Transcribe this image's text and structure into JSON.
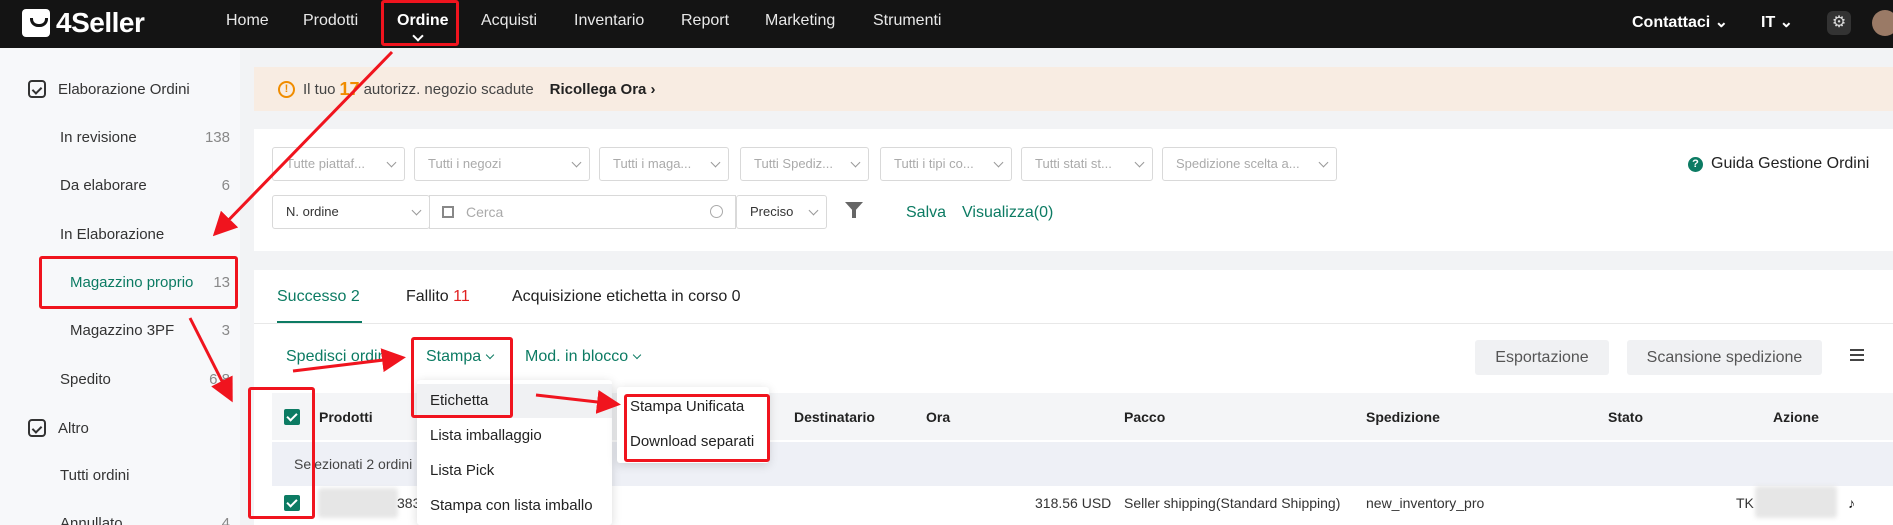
{
  "app": {
    "logo": "4Seller"
  },
  "nav": {
    "items": [
      "Home",
      "Prodotti",
      "Ordine",
      "Acquisti",
      "Inventario",
      "Report",
      "Marketing",
      "Strumenti"
    ],
    "active": "Ordine",
    "contact": "Contattaci",
    "lang": "IT"
  },
  "sidebar": {
    "group1": "Elaborazione Ordini",
    "items": [
      {
        "label": "In revisione",
        "count": "138"
      },
      {
        "label": "Da elaborare",
        "count": "6"
      },
      {
        "label": "In Elaborazione",
        "count": ""
      },
      {
        "label": "Magazzino proprio",
        "count": "13"
      },
      {
        "label": "Magazzino 3PF",
        "count": "3"
      },
      {
        "label": "Spedito",
        "count": "6.8"
      }
    ],
    "group2": "Altro",
    "items2": [
      {
        "label": "Tutti ordini",
        "count": ""
      },
      {
        "label": "Annullato",
        "count": "4"
      }
    ]
  },
  "banner": {
    "prefix": "Il tuo",
    "count": "17",
    "suffix": "autorizz. negozio scadute",
    "link": "Ricollega Ora"
  },
  "filters": {
    "selects": [
      "Tutte piattaf...",
      "Tutti i negozi",
      "Tutti i maga...",
      "Tutti Spediz...",
      "Tutti i tipi co...",
      "Tutti stati st...",
      "Spedizione scelta a..."
    ],
    "guide": "Guida Gestione Ordini",
    "search_field": "N. ordine",
    "search_placeholder": "Cerca",
    "match": "Preciso",
    "save": "Salva",
    "view": "Visualizza(0)"
  },
  "tabs": {
    "success": "Successo 2",
    "failed_label": "Fallito",
    "failed_count": "11",
    "acquiring": "Acquisizione etichetta in corso 0"
  },
  "actions": {
    "ship": "Spedisci ordine",
    "print": "Stampa",
    "bulk": "Mod. in blocco",
    "export": "Esportazione",
    "scan": "Scansione spedizione"
  },
  "table": {
    "headers": [
      "Prodotti",
      "Destinatario",
      "Ora",
      "Pacco",
      "Spedizione",
      "Stato",
      "Azione"
    ],
    "selected_text": "Selezionati 2 ordini",
    "row1": {
      "order_fragment": "383",
      "amount": "318.56 USD",
      "package": "Seller shipping(Standard Shipping)",
      "shipping": "new_inventory_pro",
      "status": "TK"
    }
  },
  "print_menu": [
    "Etichetta",
    "Lista imballaggio",
    "Lista Pick",
    "Stampa con lista imballo"
  ],
  "label_submenu": [
    "Stampa Unificata",
    "Download separati"
  ],
  "colors": {
    "accent": "#0c7b63",
    "annotation": "#f0141e",
    "warning": "#f08c00",
    "topbar": "#141414"
  }
}
